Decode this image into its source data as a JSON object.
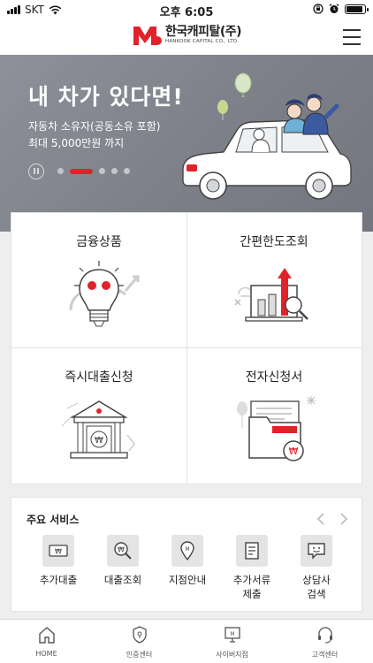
{
  "status_bar": {
    "carrier": "SKT",
    "time": "오후 6:05"
  },
  "header": {
    "logo_text": "한국캐피탈(주)",
    "logo_subtext": "HANKOOK CAPITAL CO., LTD."
  },
  "banner": {
    "title": "내 차가 있다면!",
    "line1": "자동차 소유자(공동소유 포함)",
    "line2": "최대 5,000만원 까지",
    "slide_count": 5,
    "active_slide": 2
  },
  "menu": {
    "finance_products": "금융상품",
    "quick_limit": "간편한도조회",
    "instant_loan": "즉시대출신청",
    "e_application": "전자신청서"
  },
  "services": {
    "title": "주요 서비스",
    "items": [
      {
        "label": "추가대출"
      },
      {
        "label": "대출조회"
      },
      {
        "label": "지점안내"
      },
      {
        "label": "추가서류\n제출"
      },
      {
        "label": "상담사\n검색"
      }
    ]
  },
  "tabs": [
    {
      "label": "HOME"
    },
    {
      "label": "인증센터"
    },
    {
      "label": "사이버지점"
    },
    {
      "label": "고객센터"
    }
  ],
  "colors": {
    "accent": "#e0232b",
    "banner_bg": "#80838b"
  }
}
